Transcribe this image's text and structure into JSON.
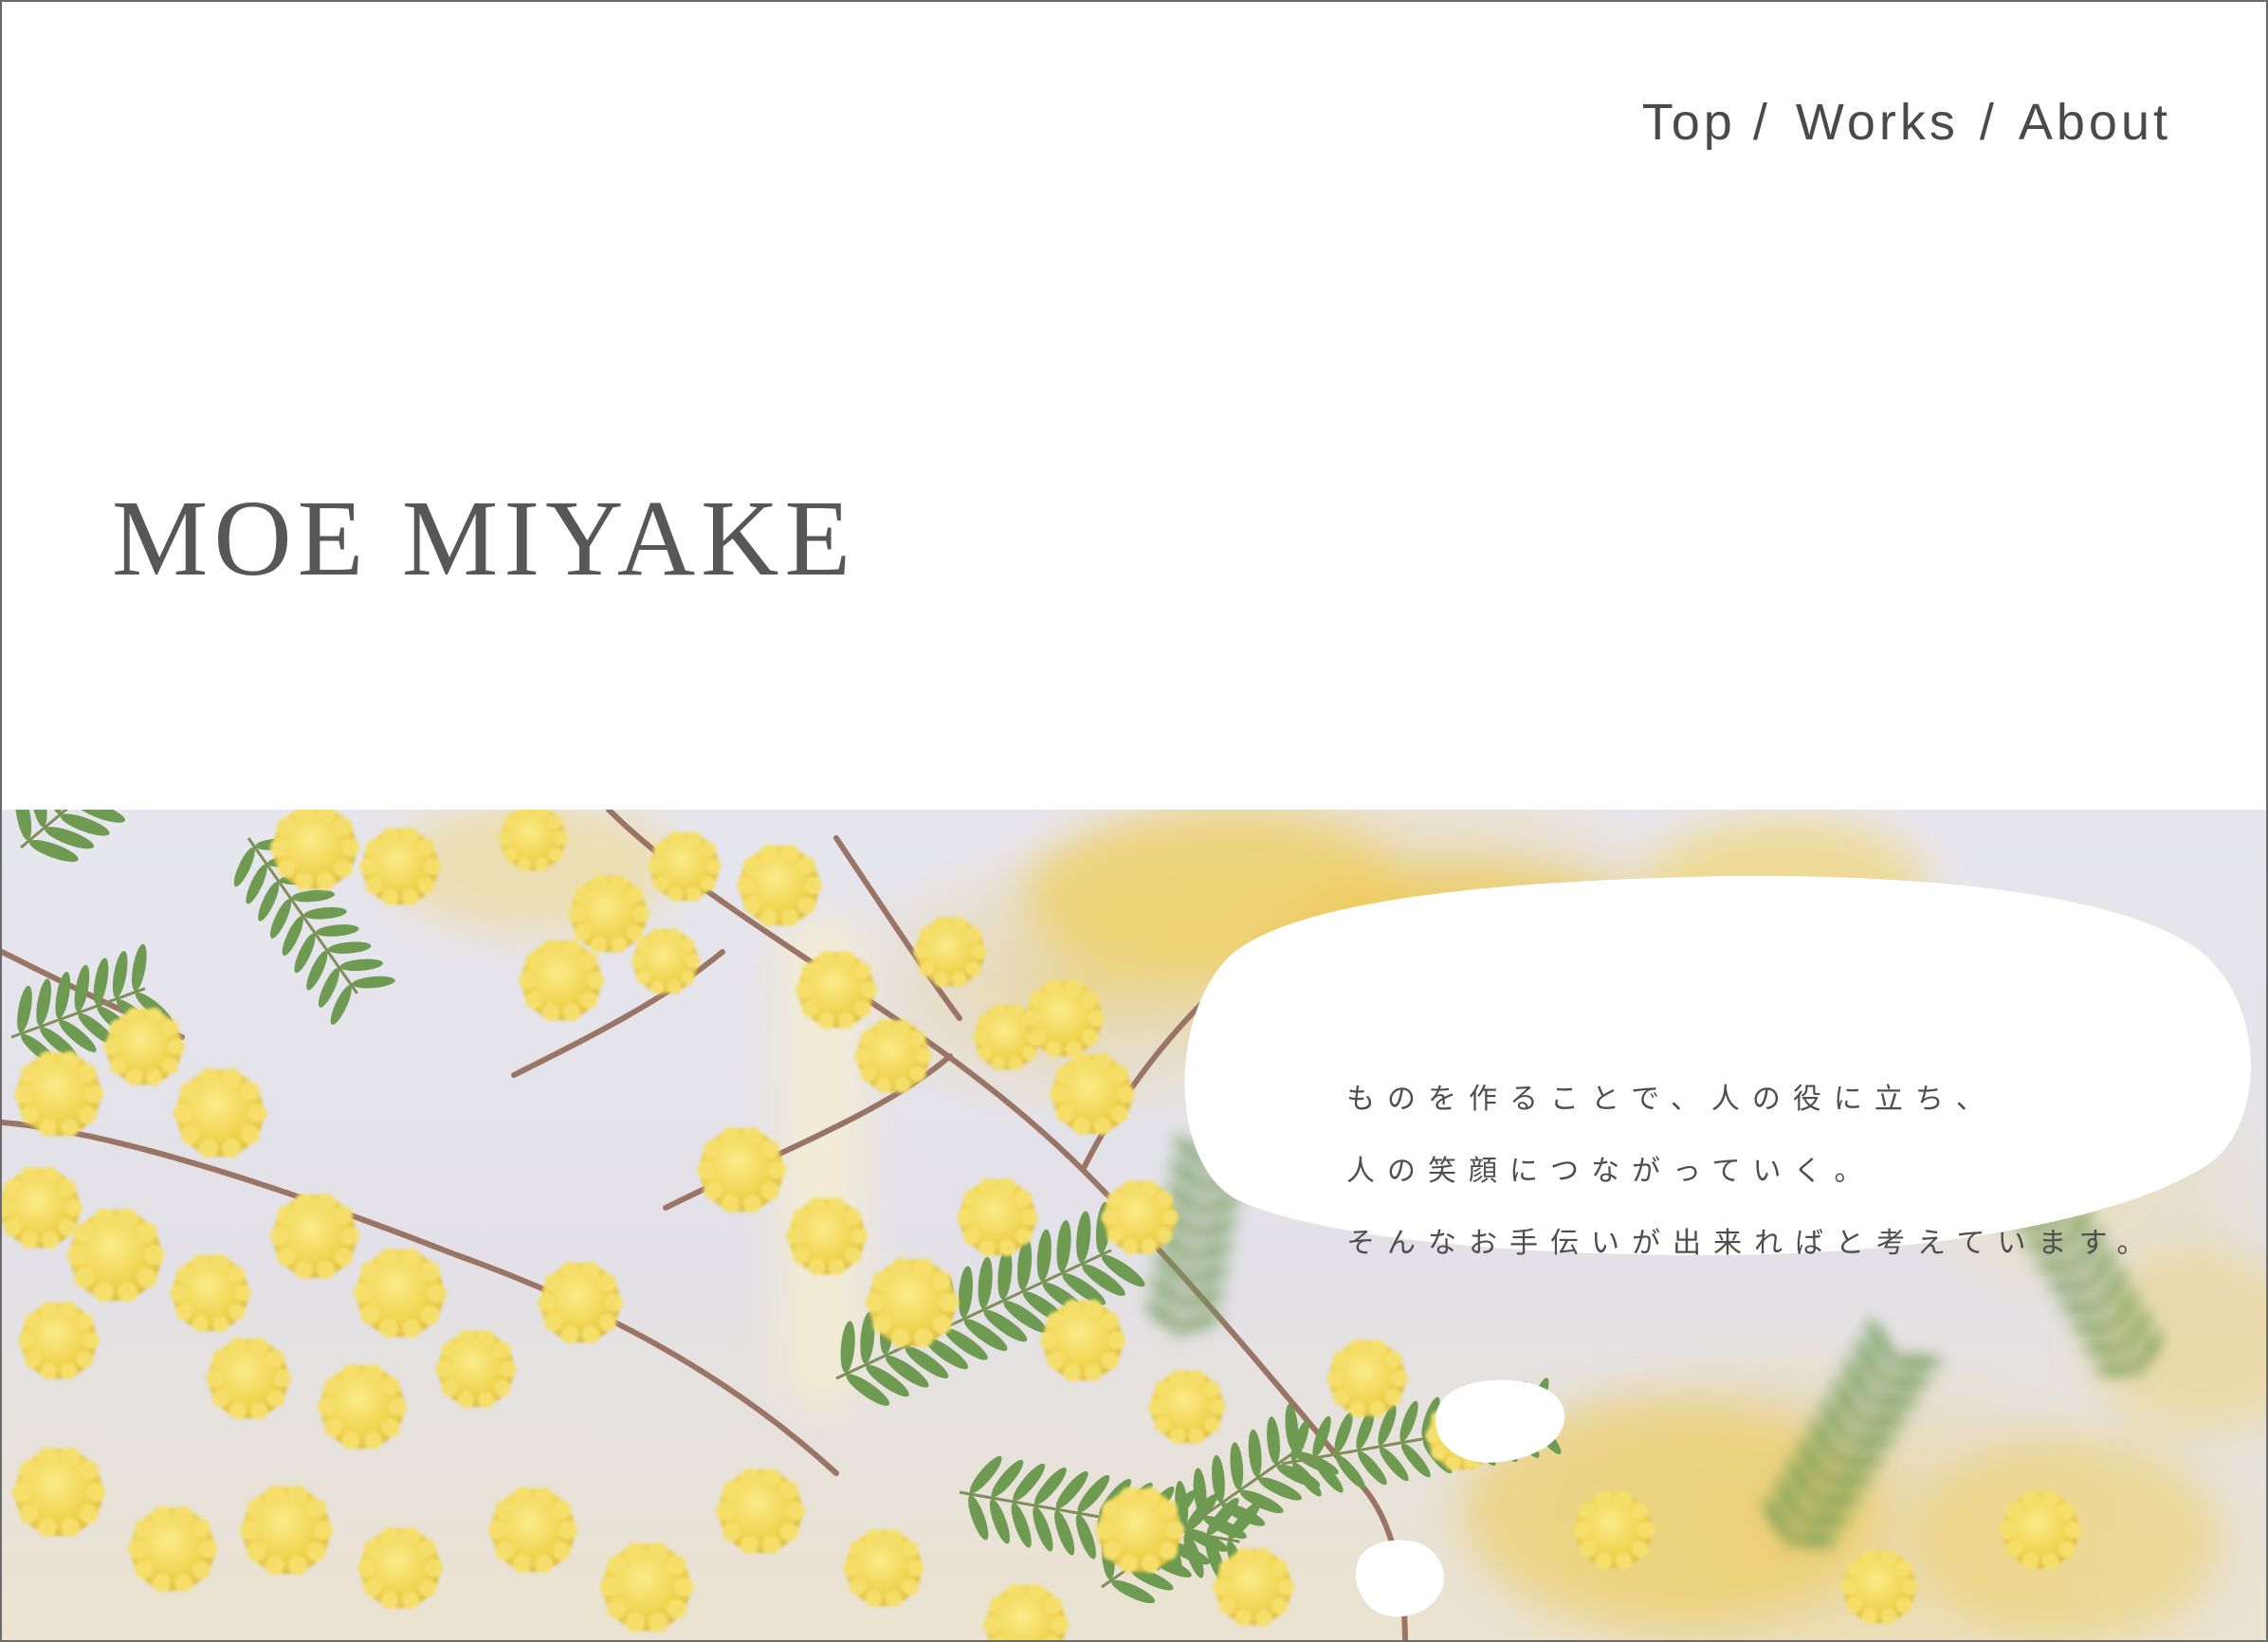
{
  "nav": {
    "items": [
      {
        "label": "Top"
      },
      {
        "label": "Works"
      },
      {
        "label": "About"
      }
    ],
    "separator": "/"
  },
  "site": {
    "title": "MOE MIYAKE"
  },
  "hero": {
    "image_subject": "mimosa-flowers",
    "message_lines": [
      "ものを作ることで、人の役に立ち、",
      "人の笑顔につながっていく。",
      "そんなお手伝いが出来ればと考えています。"
    ]
  },
  "colors": {
    "text": "#4a4a4a",
    "title": "#575757",
    "mimosa_yellow": "#f2d75a",
    "leaf_green": "#6e9a52",
    "stem": "#9a7566",
    "background_lavender": "#e6e5ec"
  }
}
